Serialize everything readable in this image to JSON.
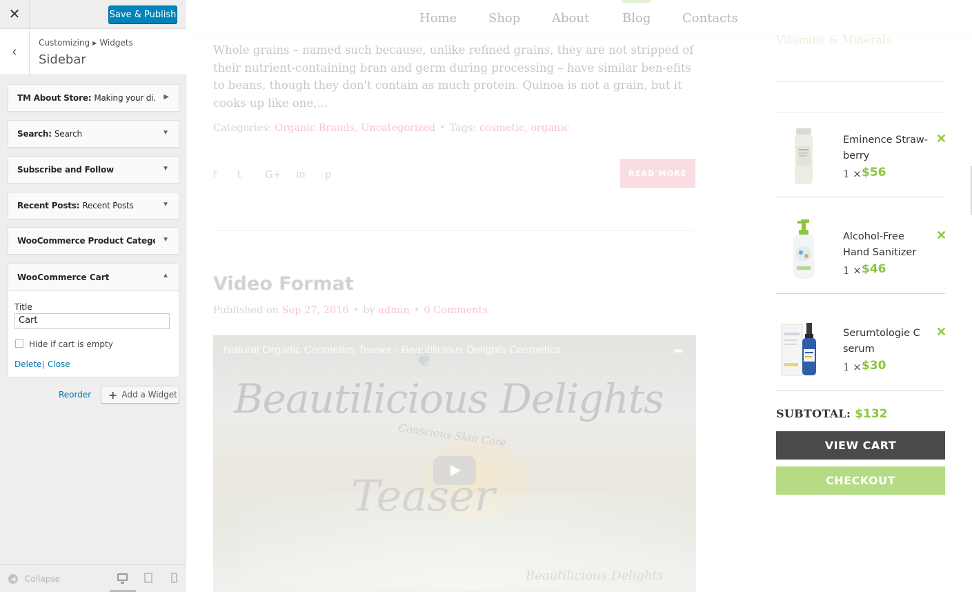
{
  "customizer": {
    "close_icon": "close-icon",
    "publish_label": "Save & Publish",
    "breadcrumb": [
      "Customizing",
      "Widgets"
    ],
    "section_title": "Sidebar",
    "widgets": [
      {
        "title": "TM About Store",
        "instance": "Making your di..."
      },
      {
        "title": "Search",
        "instance": "Search"
      },
      {
        "title": "Subscribe and Follow",
        "instance": ""
      },
      {
        "title": "Recent Posts",
        "instance": "Recent Posts"
      },
      {
        "title": "WooCommerce Product Catego...",
        "instance": ""
      }
    ],
    "open_widget": {
      "title": "WooCommerce Cart",
      "field_label": "Title",
      "field_value": "Cart",
      "checkbox_label": "Hide if cart is empty",
      "checkbox_checked": false,
      "delete_label": "Delete",
      "separator": "|",
      "close_label": "Close"
    },
    "reorder_label": "Reorder",
    "add_widget_label": "Add a Widget",
    "collapse_label": "Collapse"
  },
  "site": {
    "nav": [
      "Home",
      "Shop",
      "About",
      "Blog",
      "Contacts"
    ],
    "active_nav": "Blog",
    "excerpt": "Whole grains – named such because, unlike refined grains, they are not stripped of their nutrient-containing bran and germ during processing – have similar ben-efits to beans, though they don't contain as much protein. Quinoa is not a grain, but it cooks up like one,...",
    "meta": {
      "categories_label": "Categories:",
      "categories": "Organic Brands, Uncategorized",
      "tags_label": "Tags:",
      "tags": "cosmetic, organic"
    },
    "social_icons": [
      "facebook-icon",
      "twitter-icon",
      "google-plus-icon",
      "linkedin-icon",
      "pinterest-icon"
    ],
    "social_glyphs": [
      "f",
      "t",
      "G+",
      "in",
      "p"
    ],
    "read_more": "READ MORE",
    "post": {
      "title": "Video Format",
      "published_label": "Published on",
      "date": "Sep 27, 2016",
      "by_label": "by",
      "author": "admin",
      "comments": "0 Comments"
    },
    "video": {
      "title": "Natural Organic Cosmetics Teaser - Beautilicious Delights Cosmetics",
      "brand": "Beautilicious Delights",
      "tagline": "Conscious Skin Care",
      "teaser": "Teaser",
      "watermark": "Beautilicious Delights"
    }
  },
  "cart": {
    "previous_widget_title": "Vitamins & Minerals",
    "items": [
      {
        "name": "Eminence Straw-berry",
        "qty": "1 ×",
        "price": "$56"
      },
      {
        "name": "Alcohol-Free Hand Sanitizer",
        "qty": "1 ×",
        "price": "$46"
      },
      {
        "name": "Serumtologie C serum",
        "qty": "1 ×",
        "price": "$30"
      }
    ],
    "remove_glyph": "✕",
    "subtotal_label": "SUBTOTAL:",
    "subtotal_value": "$132",
    "view_cart": "VIEW CART",
    "checkout": "CHECKOUT"
  },
  "colors": {
    "accent_green": "#8cc63f",
    "checkout_green": "#b5dc84",
    "publish_blue": "#0085ba",
    "pink": "#f6c4cd",
    "dark_button": "#4a4a4a"
  }
}
